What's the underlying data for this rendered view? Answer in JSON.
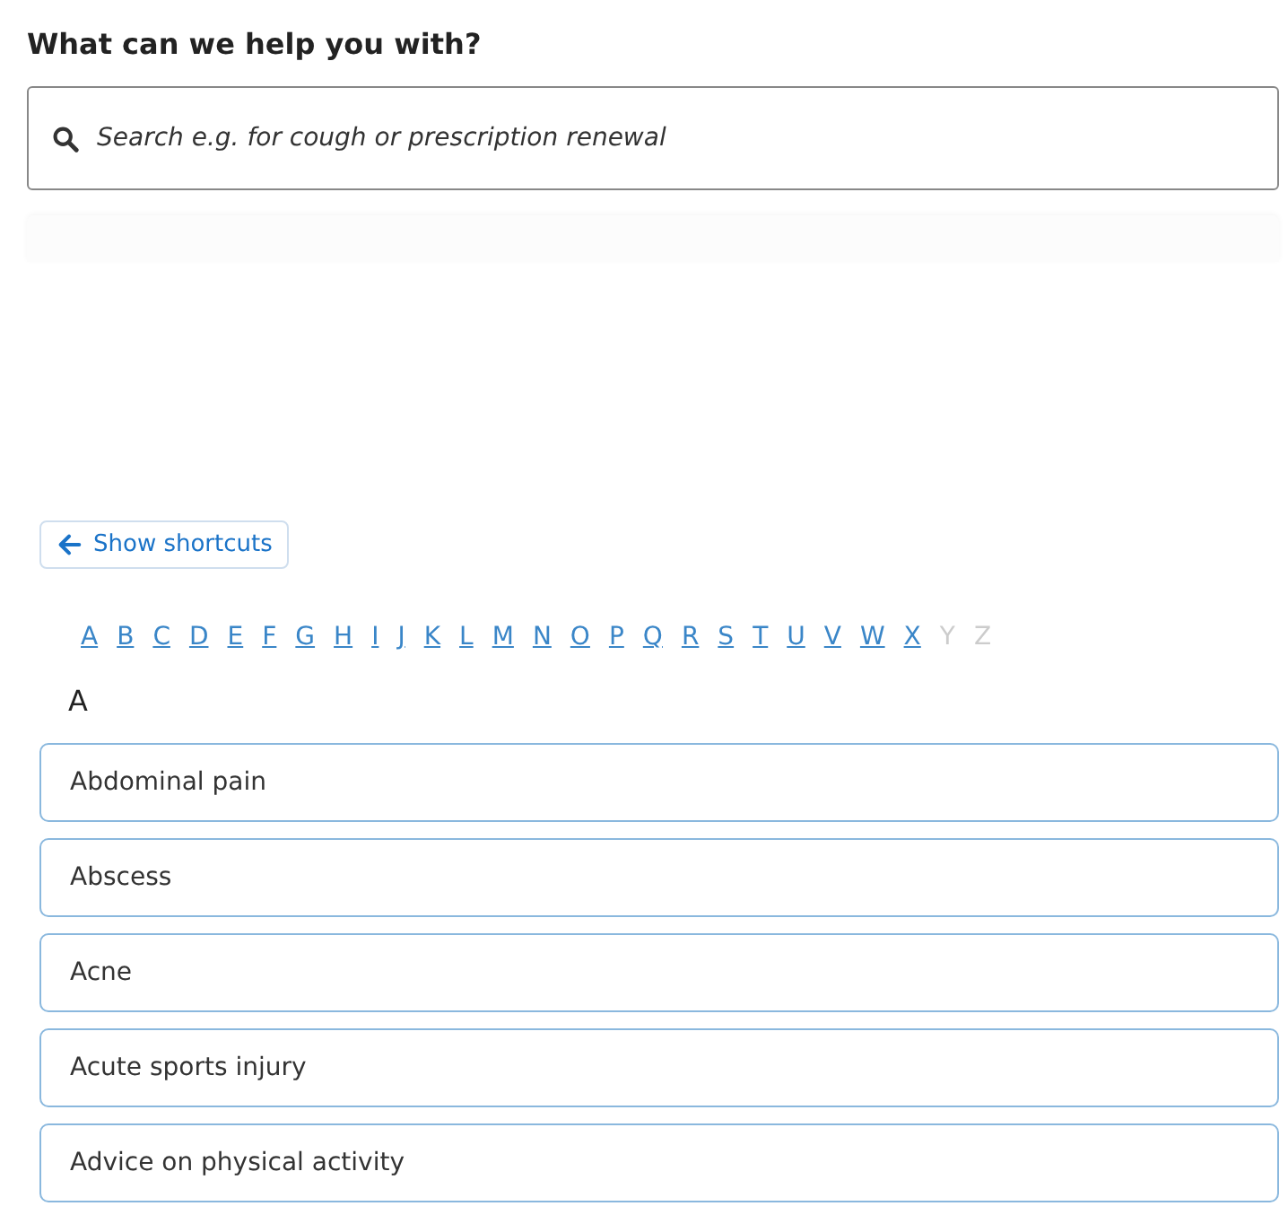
{
  "heading": "What can we help you with?",
  "search": {
    "placeholder": "Search e.g. for cough or prescription renewal"
  },
  "shortcuts_button": "Show shortcuts",
  "letters": [
    {
      "label": "A",
      "disabled": false
    },
    {
      "label": "B",
      "disabled": false
    },
    {
      "label": "C",
      "disabled": false
    },
    {
      "label": "D",
      "disabled": false
    },
    {
      "label": "E",
      "disabled": false
    },
    {
      "label": "F",
      "disabled": false
    },
    {
      "label": "G",
      "disabled": false
    },
    {
      "label": "H",
      "disabled": false
    },
    {
      "label": "I",
      "disabled": false
    },
    {
      "label": "J",
      "disabled": false
    },
    {
      "label": "K",
      "disabled": false
    },
    {
      "label": "L",
      "disabled": false
    },
    {
      "label": "M",
      "disabled": false
    },
    {
      "label": "N",
      "disabled": false
    },
    {
      "label": "O",
      "disabled": false
    },
    {
      "label": "P",
      "disabled": false
    },
    {
      "label": "Q",
      "disabled": false
    },
    {
      "label": "R",
      "disabled": false
    },
    {
      "label": "S",
      "disabled": false
    },
    {
      "label": "T",
      "disabled": false
    },
    {
      "label": "U",
      "disabled": false
    },
    {
      "label": "V",
      "disabled": false
    },
    {
      "label": "W",
      "disabled": false
    },
    {
      "label": "X",
      "disabled": false
    },
    {
      "label": "Y",
      "disabled": true
    },
    {
      "label": "Z",
      "disabled": true
    }
  ],
  "section": {
    "letter": "A",
    "items": [
      "Abdominal pain",
      "Abscess",
      "Acne",
      "Acute sports injury",
      "Advice on physical activity"
    ]
  }
}
